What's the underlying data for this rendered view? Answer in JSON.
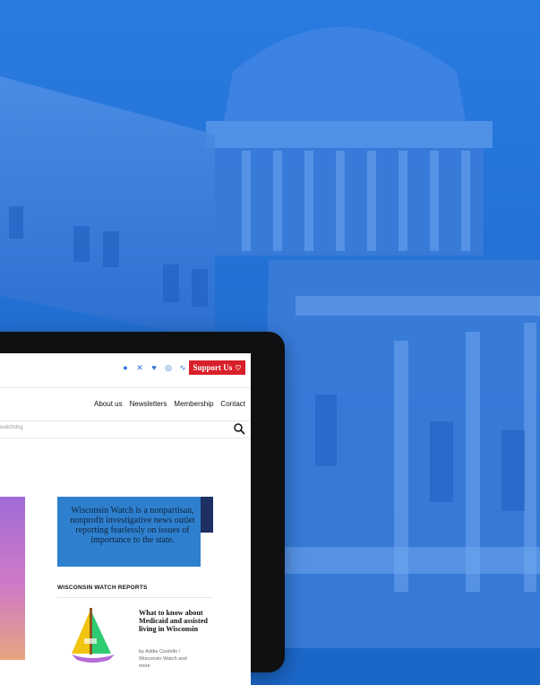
{
  "tablet": {
    "social_icons": [
      "facebook-icon",
      "x-icon",
      "twitter-icon",
      "instagram-icon",
      "rss-icon"
    ],
    "support_label": "Support Us",
    "nav_items": [
      "About us",
      "Newsletters",
      "Membership",
      "Contact"
    ],
    "search_placeholder": "watchdog",
    "mission_text": "Wisconsin Watch is a nonpartisan, nonprofit investigative news outlet reporting fearlessly on issues of importance to the state.",
    "reports_title": "WISCONSIN WATCH REPORTS",
    "article": {
      "headline": "What to know about Medicaid and assisted living in Wisconsin",
      "byline_line1": "by Addie Costello /",
      "byline_line2": "Wisconsin Watch and",
      "byline_line3": "more"
    }
  },
  "colors": {
    "background_blue": "#1b67c8",
    "support_red": "#d8202a",
    "mission_blue": "#2e80cf"
  }
}
